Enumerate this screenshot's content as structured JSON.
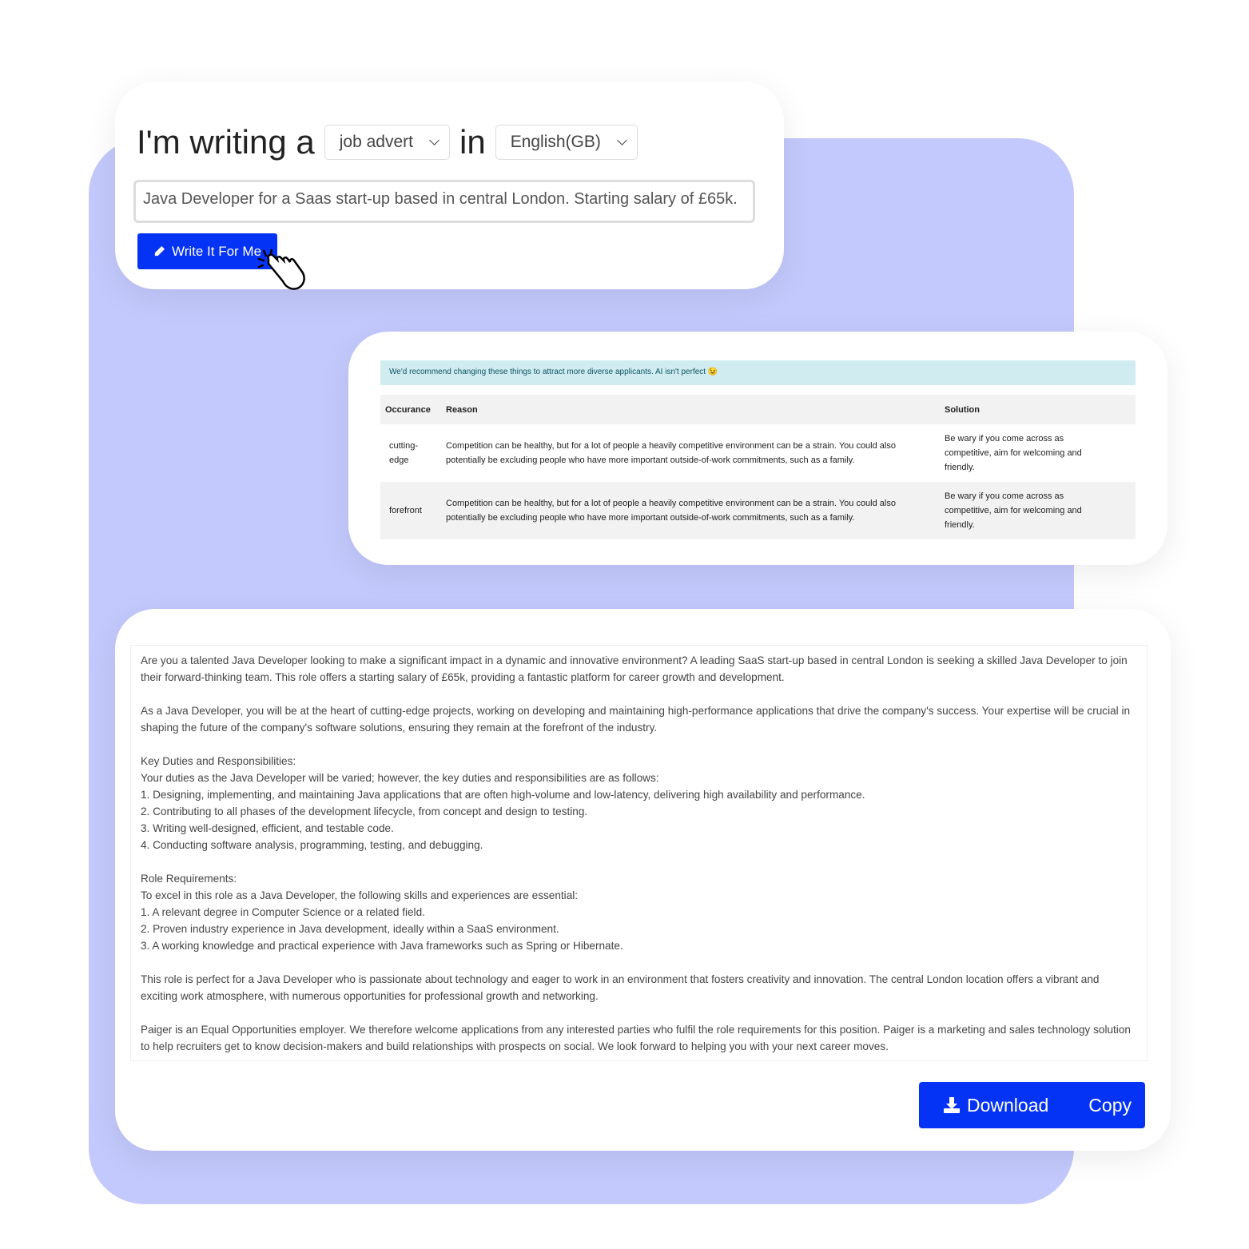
{
  "composer": {
    "prefix": "I'm writing a",
    "type_value": "job advert",
    "connector": "in",
    "language_value": "English(GB)",
    "prompt_value": "Java Developer for a Saas start-up based in central London. Starting salary of £65k.",
    "write_label": "Write It For Me"
  },
  "suggestions": {
    "alert": "We'd recommend changing these things to attract more diverse applicants. AI isn't perfect 😉",
    "columns": [
      "Occurance",
      "Reason",
      "Solution"
    ],
    "rows": [
      {
        "occurance": "cutting-edge",
        "reason": "Competition can be healthy, but for a lot of people a heavily competitive environment can be a strain. You could also potentially be excluding people who have more important outside-of-work commitments, such as a family.",
        "solution": "Be wary if you come across as competitive, aim for welcoming and friendly."
      },
      {
        "occurance": "forefront",
        "reason": "Competition can be healthy, but for a lot of people a heavily competitive environment can be a strain. You could also potentially be excluding people who have more important outside-of-work commitments, such as a family.",
        "solution": "Be wary if you come across as competitive, aim for welcoming and friendly."
      }
    ]
  },
  "output": {
    "paragraphs": [
      [
        "Are you a talented Java Developer looking to make a significant impact in a dynamic and innovative environment? A leading SaaS start-up based in central London is seeking a skilled Java Developer to join their forward-thinking team. This role offers a starting salary of £65k, providing a fantastic platform for career growth and development."
      ],
      [
        "As a Java Developer, you will be at the heart of cutting-edge projects, working on developing and maintaining high-performance applications that drive the company's success. Your expertise will be crucial in shaping the future of the company's software solutions, ensuring they remain at the forefront of the industry."
      ],
      [
        "Key Duties and Responsibilities:",
        "Your duties as the Java Developer will be varied; however, the key duties and responsibilities are as follows:",
        "1. Designing, implementing, and maintaining Java applications that are often high-volume and low-latency, delivering high availability and performance.",
        "2. Contributing to all phases of the development lifecycle, from concept and design to testing.",
        "3. Writing well-designed, efficient, and testable code.",
        "4. Conducting software analysis, programming, testing, and debugging."
      ],
      [
        "Role Requirements:",
        "To excel in this role as a Java Developer, the following skills and experiences are essential:",
        "1. A relevant degree in Computer Science or a related field.",
        "2. Proven industry experience in Java development, ideally within a SaaS environment.",
        "3. A working knowledge and practical experience with Java frameworks such as Spring or Hibernate."
      ],
      [
        "This role is perfect for a Java Developer who is passionate about technology and eager to work in an environment that fosters creativity and innovation. The central London location offers a vibrant and exciting work atmosphere, with numerous opportunities for professional growth and networking."
      ],
      [
        "Paiger is an Equal Opportunities employer. We therefore welcome applications from any interested parties who fulfil the role requirements for this position. Paiger is a marketing and sales technology solution to help recruiters get to know decision-makers and build relationships with prospects on social. We look forward to helping you with your next career moves."
      ]
    ],
    "download_label": "Download",
    "copy_label": "Copy"
  },
  "colors": {
    "accent": "#0533f5",
    "backdrop": "#c3c9fc",
    "alert_bg": "#d1ecf1"
  }
}
